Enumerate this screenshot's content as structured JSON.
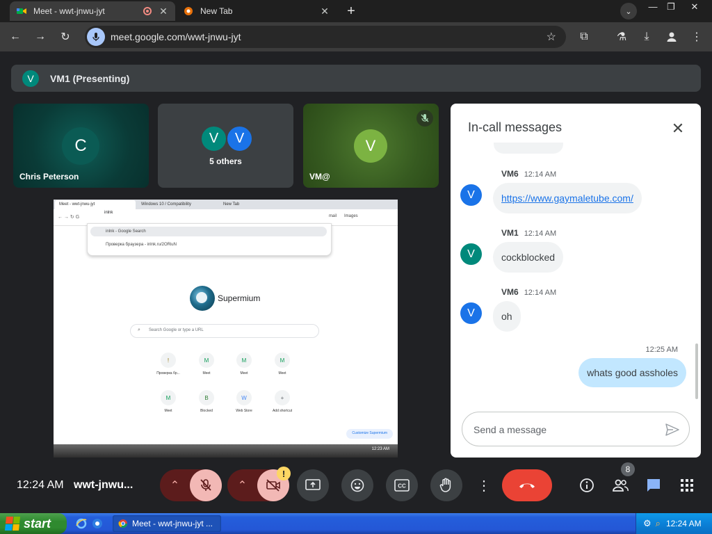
{
  "browser": {
    "tabs": [
      {
        "title": "Meet - wwt-jnwu-jyt",
        "active": true
      },
      {
        "title": "New Tab",
        "active": false
      }
    ],
    "url": "meet.google.com/wwt-jnwu-jyt"
  },
  "meet": {
    "presenting_initial": "V",
    "presenting_label": "VM1 (Presenting)",
    "tiles": [
      {
        "initial": "C",
        "name": "Chris Peterson"
      },
      {
        "initials": [
          "V",
          "V"
        ],
        "name": "5 others"
      },
      {
        "initial": "V",
        "name": "VM@",
        "muted": true
      }
    ],
    "shared_screen": {
      "tabs": [
        "Meet - wwt-jnwu-jyt",
        "Windows 10 / Compatibility",
        "New Tab"
      ],
      "omnibox_text": "inlnk",
      "suggestions": [
        "inlnk - Google Search",
        "Проверка браузера - inlnk.ru/2ORiuN"
      ],
      "toolbar_links": [
        "mail",
        "Images"
      ],
      "logo_text": "Supermium",
      "search_placeholder": "Search Google or type a URL",
      "shortcuts": [
        {
          "label": "Проверка бр...",
          "icon": "!"
        },
        {
          "label": "Meet",
          "icon": "M"
        },
        {
          "label": "Meet",
          "icon": "M"
        },
        {
          "label": "Meet",
          "icon": "M"
        },
        {
          "label": "Meet",
          "icon": "M"
        },
        {
          "label": "Blocked",
          "icon": "B"
        },
        {
          "label": "Web Store",
          "icon": "W"
        },
        {
          "label": "Add shortcut",
          "icon": "+"
        }
      ],
      "customize_label": "Customize Supermium",
      "taskbar_time": "12:23 AM"
    }
  },
  "chat": {
    "title": "In-call messages",
    "messages": [
      {
        "sender": "VM6",
        "time": "12:14 AM",
        "initial": "V",
        "text": "https://www.gaymaletube.com/",
        "is_link": true,
        "avatar_color": "#1a73e8"
      },
      {
        "sender": "VM1",
        "time": "12:14 AM",
        "initial": "V",
        "text": "cockblocked",
        "is_link": false,
        "avatar_color": "#00897b"
      },
      {
        "sender": "VM6",
        "time": "12:14 AM",
        "initial": "V",
        "text": "oh",
        "is_link": false,
        "avatar_color": "#1a73e8"
      }
    ],
    "own_message": {
      "time": "12:25 AM",
      "text": "whats good assholes"
    },
    "input_placeholder": "Send a message"
  },
  "controls": {
    "clock": "12:24 AM",
    "meeting_code": "wwt-jnwu...",
    "people_count": "8",
    "warning": "!"
  },
  "taskbar": {
    "start_label": "start",
    "task_label": "Meet - wwt-jnwu-jyt ...",
    "clock": "12:24 AM"
  },
  "colors": {
    "accent_blue": "#1a73e8",
    "end_call_red": "#ea4335",
    "own_bubble": "#c2e7ff",
    "meet_bg": "#202124"
  }
}
